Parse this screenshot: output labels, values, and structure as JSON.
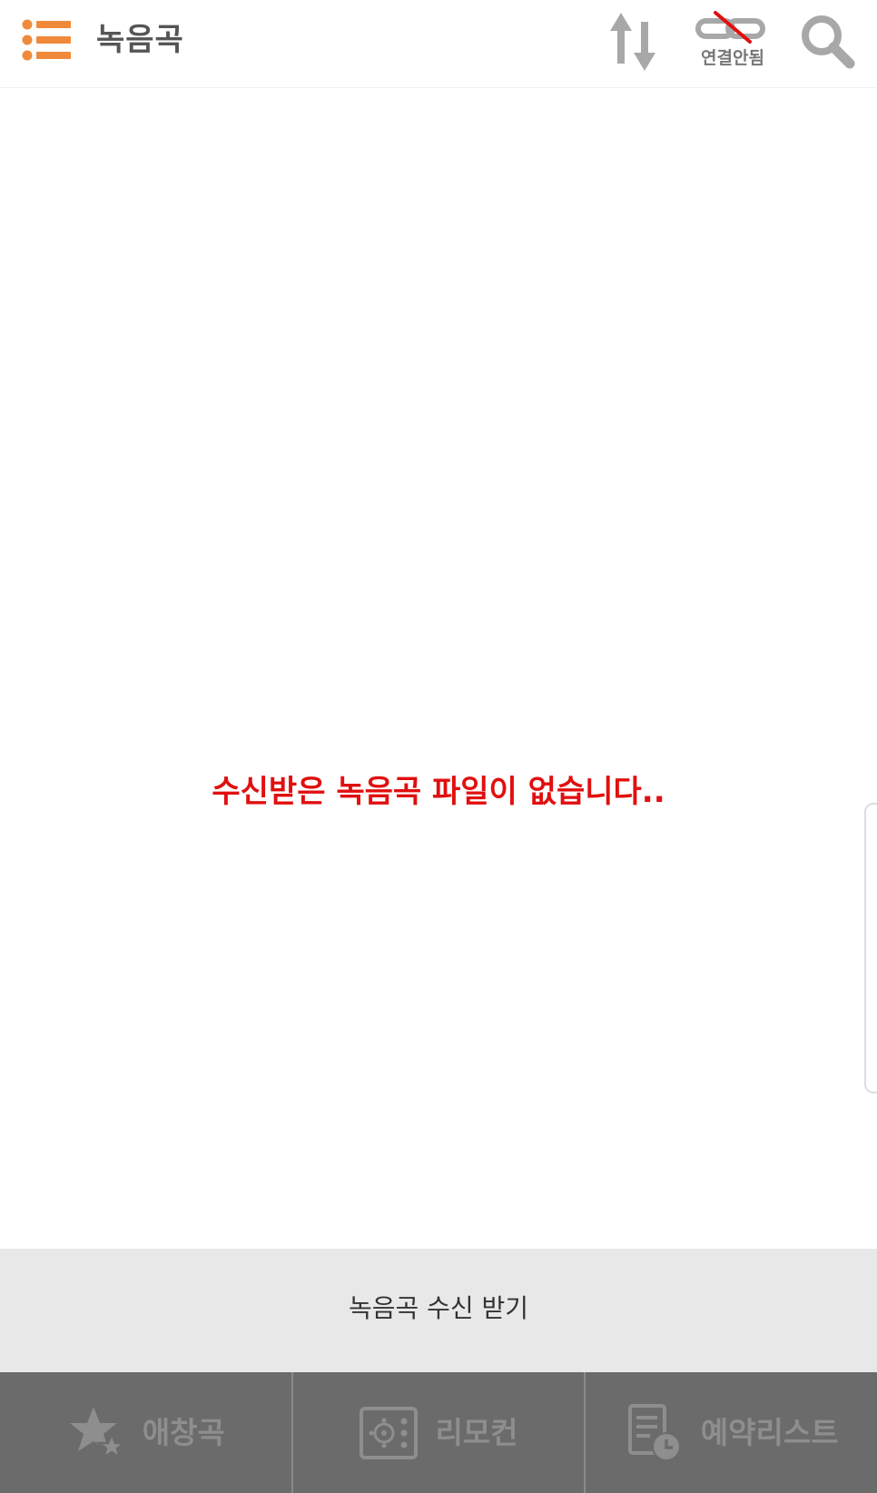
{
  "header": {
    "title": "녹음곡",
    "menu_icon": "list-menu-icon",
    "sort_icon": "sort-arrows-icon",
    "connection": {
      "icon": "link-broken-icon",
      "label": "연결안됨"
    },
    "search_icon": "search-icon"
  },
  "content": {
    "empty_message": "수신받은 녹음곡 파일이 없습니다.."
  },
  "receive_bar": {
    "label": "녹음곡 수신 받기"
  },
  "bottom_nav": {
    "items": [
      {
        "label": "애창곡",
        "icon": "star-icon"
      },
      {
        "label": "리모컨",
        "icon": "remote-icon"
      },
      {
        "label": "예약리스트",
        "icon": "reservation-list-icon"
      }
    ]
  },
  "colors": {
    "accent": "#f08a3a",
    "empty_message": "#e10f0f",
    "icon_gray": "#a8a8a8",
    "nav_background": "#6b6b6b",
    "receive_bar_background": "#e8e8e8"
  }
}
